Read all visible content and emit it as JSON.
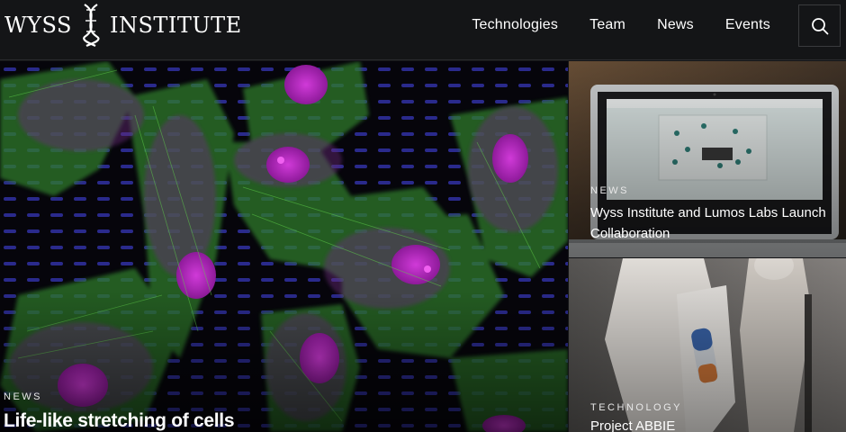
{
  "header": {
    "logo_left": "WYSS",
    "logo_right": "INSTITUTE",
    "nav": [
      "Technologies",
      "Team",
      "News",
      "Events"
    ]
  },
  "hero": {
    "eyebrow": "NEWS",
    "title": "Life-like stretching of cells"
  },
  "cards": [
    {
      "eyebrow": "NEWS",
      "title": "Wyss Institute and Lumos Labs Launch Collaboration"
    },
    {
      "eyebrow": "TECHNOLOGY",
      "title": "Project ABBIE"
    }
  ],
  "colors": {
    "header_bg": "#141517",
    "text": "#ffffff"
  }
}
